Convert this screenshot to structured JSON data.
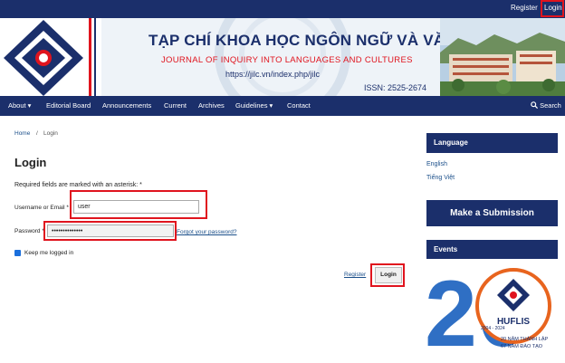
{
  "topbar": {
    "register": "Register",
    "login": "Login"
  },
  "banner": {
    "title_vi": "TẠP CHÍ KHOA HỌC NGÔN NGỮ VÀ VĂN HÓA",
    "title_en": "JOURNAL OF INQUIRY INTO LANGUAGES AND CULTURES",
    "url": "https://jilc.vn/index.php/jilc",
    "issn": "ISSN: 2525-2674"
  },
  "nav": {
    "items": [
      "About ▾",
      "Editorial Board",
      "Announcements",
      "Current",
      "Archives",
      "Guidelines ▾",
      "Contact"
    ],
    "search": "Search"
  },
  "breadcrumb": {
    "home": "Home",
    "separator": "/",
    "current": "Login"
  },
  "form": {
    "title": "Login",
    "required_note": "Required fields are marked with an asterisk: *",
    "username_label": "Username or Email *",
    "username_value": "user",
    "password_label": "Password *",
    "password_value": "••••••••••••••",
    "forgot": "Forgot your password?",
    "keep_logged": "Keep me logged in",
    "register": "Register",
    "login": "Login"
  },
  "sidebar": {
    "language_title": "Language",
    "languages": [
      "English",
      "Tiếng Việt"
    ],
    "submission": "Make a Submission",
    "events_title": "Events",
    "event_number": "20",
    "event_brand": "HUFLIS",
    "event_years": "2004 - 2024",
    "event_line1": "20 NĂM THÀNH LẬP",
    "event_line2": "67 NĂM ĐÀO TẠO"
  },
  "colors": {
    "navy": "#1b2f6b",
    "red": "#e0141e",
    "link": "#1b4f8a"
  },
  "icons": {
    "search": "search-icon",
    "logo": "journal-logo-icon"
  }
}
